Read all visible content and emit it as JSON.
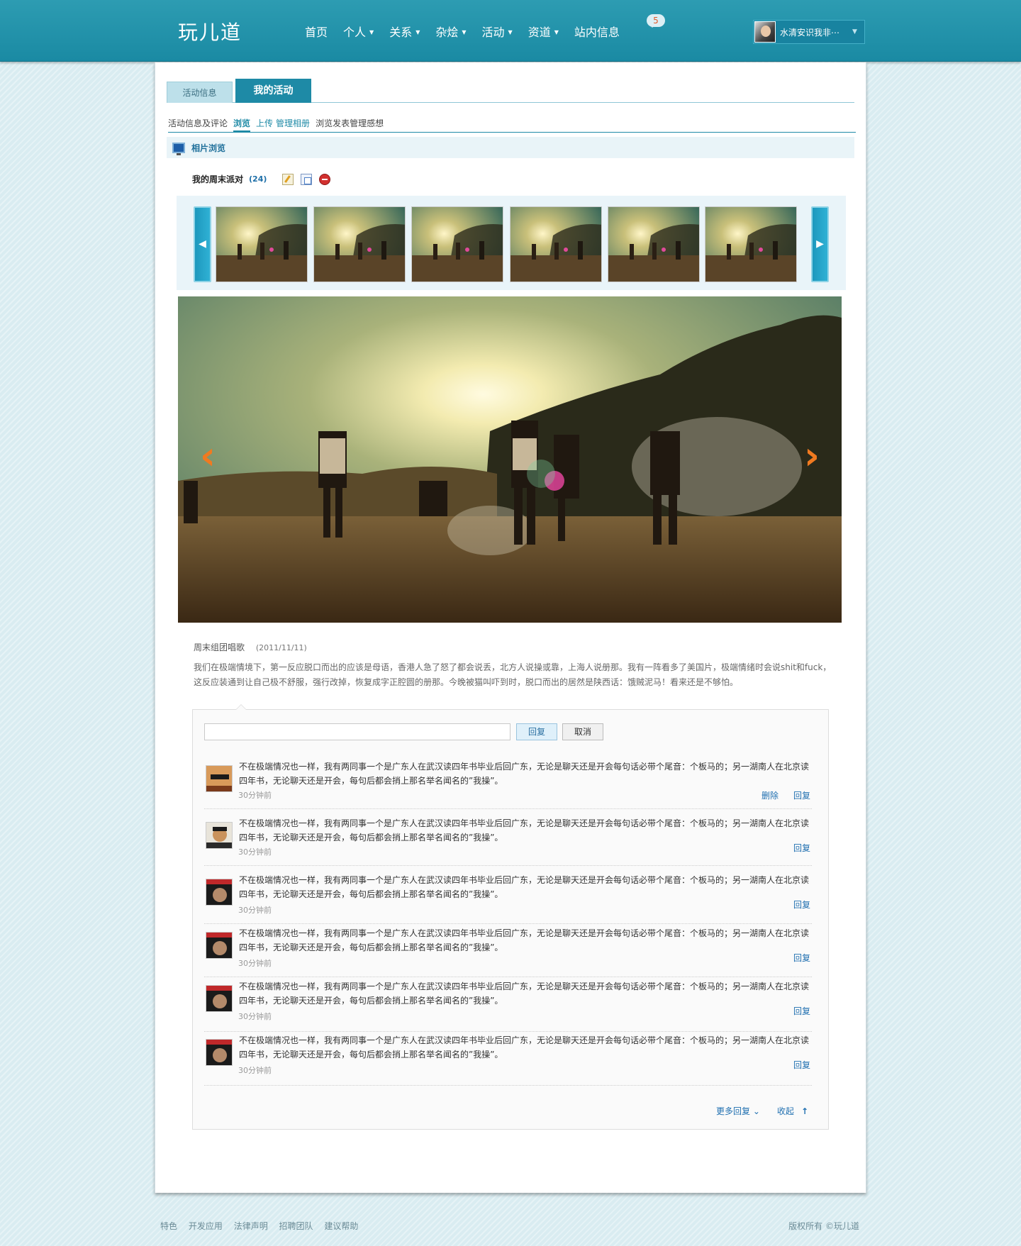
{
  "header": {
    "logo": "玩儿道",
    "nav": [
      {
        "label": "首页",
        "has_dropdown": false
      },
      {
        "label": "个人",
        "has_dropdown": true
      },
      {
        "label": "关系",
        "has_dropdown": true
      },
      {
        "label": "杂烩",
        "has_dropdown": true
      },
      {
        "label": "活动",
        "has_dropdown": true
      },
      {
        "label": "资道",
        "has_dropdown": true
      },
      {
        "label": "站内信息",
        "has_dropdown": false
      }
    ],
    "message_badge": "5",
    "username": "水清安识我非⋯",
    "caret": "▼"
  },
  "tabs": {
    "info": "活动信息",
    "mine": "我的活动"
  },
  "subnav": {
    "info_comments": "活动信息及评论",
    "browse": "浏览",
    "upload": "上传",
    "manage_album": "管理相册",
    "browse_post": "浏览发表管理感想"
  },
  "section": {
    "title": "相片浏览"
  },
  "album": {
    "name": "我的周末派对",
    "count": "(24)"
  },
  "strip": {
    "prev": "◀",
    "next": "▶"
  },
  "photo": {
    "prev": "‹",
    "next": "›"
  },
  "caption": {
    "title": "周末组团唱歌",
    "date": "(2011/11/11)",
    "text": "我们在极端情境下，第一反应脱口而出的应该是母语，香港人急了怒了都会说丢，北方人说操或靠，上海人说册那。我有一阵看多了美国片，极端情绪时会说shit和fuck，这反应装通到让自己极不舒服，强行改掉，恢复成字正腔圆的册那。今晚被猫叫吓到时，脱口而出的居然是陕西话：饿贼泥马！看来还是不够怕。"
  },
  "reply_box": {
    "placeholder": "",
    "reply": "回复",
    "cancel": "取消"
  },
  "comments": [
    {
      "text": "不在极端情况也一样，我有两同事一个是广东人在武汉读四年书毕业后回广东，无论是聊天还是开会每句话必带个尾音：个板马的；另一湖南人在北京读四年书，无论聊天还是开会，每句后都会捎上那名举名闻名的”我操”。",
      "time": "30分钟前",
      "actions": [
        "删除",
        "回复"
      ]
    },
    {
      "text": "不在极端情况也一样，我有两同事一个是广东人在武汉读四年书毕业后回广东，无论是聊天还是开会每句话必带个尾音：个板马的；另一湖南人在北京读四年书，无论聊天还是开会，每句后都会捎上那名举名闻名的”我操”。",
      "time": "30分钟前",
      "actions": [
        "回复"
      ]
    },
    {
      "text": "不在极端情况也一样，我有两同事一个是广东人在武汉读四年书毕业后回广东，无论是聊天还是开会每句话必带个尾音：个板马的；另一湖南人在北京读四年书，无论聊天还是开会，每句后都会捎上那名举名闻名的”我操”。",
      "time": "30分钟前",
      "actions": [
        "回复"
      ]
    },
    {
      "text": "不在极端情况也一样，我有两同事一个是广东人在武汉读四年书毕业后回广东，无论是聊天还是开会每句话必带个尾音：个板马的；另一湖南人在北京读四年书，无论聊天还是开会，每句后都会捎上那名举名闻名的”我操”。",
      "time": "30分钟前",
      "actions": [
        "回复"
      ]
    },
    {
      "text": "不在极端情况也一样，我有两同事一个是广东人在武汉读四年书毕业后回广东，无论是聊天还是开会每句话必带个尾音：个板马的；另一湖南人在北京读四年书，无论聊天还是开会，每句后都会捎上那名举名闻名的”我操”。",
      "time": "30分钟前",
      "actions": [
        "回复"
      ]
    },
    {
      "text": "不在极端情况也一样，我有两同事一个是广东人在武汉读四年书毕业后回广东，无论是聊天还是开会每句话必带个尾音：个板马的；另一湖南人在北京读四年书，无论聊天还是开会，每句后都会捎上那名举名闻名的”我操”。",
      "time": "30分钟前",
      "actions": [
        "回复"
      ]
    }
  ],
  "more": {
    "more_replies": "更多回复",
    "collapse": "收起",
    "more_icon": "chevron-down",
    "collapse_icon": "arrow-up"
  },
  "footer": {
    "links": [
      "特色",
      "开发应用",
      "法律声明",
      "招聘团队",
      "建议帮助"
    ],
    "copyright": "版权所有 ©玩儿道"
  },
  "colors": {
    "brand": "#1e8aa6",
    "link": "#1f6fb0",
    "accent_arrow": "#f07a20"
  }
}
